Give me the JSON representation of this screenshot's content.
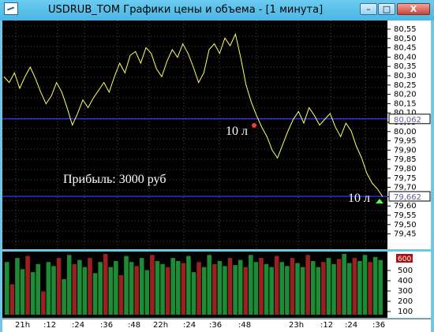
{
  "window": {
    "title": "USDRUB_TOM Графики цены и объема - [1 минута]",
    "controls": {
      "minimize": "–",
      "maximize": "□",
      "close": "X"
    }
  },
  "price_panel": {
    "y_ticks": [
      "80,55",
      "80,50",
      "80,45",
      "80,40",
      "80,35",
      "80,30",
      "80,25",
      "80,20",
      "80,15",
      "80,10",
      "80,05",
      "80,00",
      "79,95",
      "79,90",
      "79,85",
      "79,80",
      "79,75",
      "79,70",
      "79,65",
      "79,60",
      "79,55",
      "79,50",
      "79,45"
    ],
    "level_labels": [
      "80,062",
      "79,662"
    ],
    "annotations": {
      "profit": "Прибыль: 3000 руб",
      "lot_sell": "10 л",
      "lot_buy": "10 л"
    }
  },
  "volume_panel": {
    "y_ticks": [
      "500",
      "400",
      "300",
      "200",
      "100"
    ],
    "current_value": "600"
  },
  "time_axis": {
    "labels": [
      "21h",
      ":12",
      ":24",
      ":36",
      ":48",
      "22h",
      ":24",
      ":36",
      ":48",
      "23h",
      ":12",
      ":24",
      ":36"
    ]
  },
  "chart_data": {
    "type": "line",
    "title": "",
    "y_range": [
      79.45,
      80.55
    ],
    "price_series_approx": [
      80.28,
      80.25,
      80.3,
      80.22,
      80.28,
      80.33,
      80.27,
      80.2,
      80.14,
      80.18,
      80.25,
      80.2,
      80.12,
      80.03,
      80.09,
      80.16,
      80.12,
      80.17,
      80.21,
      80.25,
      80.2,
      80.28,
      80.35,
      80.3,
      80.39,
      80.41,
      80.35,
      80.43,
      80.4,
      80.32,
      80.28,
      80.36,
      80.42,
      80.38,
      80.45,
      80.4,
      80.33,
      80.25,
      80.3,
      80.42,
      80.45,
      80.4,
      80.48,
      80.44,
      80.5,
      80.38,
      80.24,
      80.15,
      80.08,
      80.02,
      79.97,
      79.9,
      79.86,
      79.93,
      80.0,
      80.06,
      80.1,
      80.04,
      80.12,
      80.08,
      80.03,
      80.06,
      80.09,
      80.02,
      79.97,
      80.04,
      80.0,
      79.92,
      79.86,
      79.78,
      79.73,
      79.7,
      79.66
    ],
    "reference_levels": [
      80.062,
      79.662
    ],
    "volume_range": [
      0,
      600
    ],
    "volume_series_approx": [
      520,
      300,
      560,
      450,
      580,
      420,
      500,
      230,
      520,
      480,
      560,
      350,
      590,
      500,
      540,
      470,
      560,
      410,
      520,
      600,
      470,
      530,
      390,
      580,
      520,
      480,
      560,
      440,
      590,
      530,
      500,
      470,
      560,
      530,
      510,
      580,
      420,
      520,
      470,
      590,
      500,
      530,
      480,
      560,
      490,
      540,
      470,
      590,
      520,
      560,
      500,
      470,
      580,
      520,
      480,
      560,
      510,
      470,
      590,
      530,
      470,
      520,
      560,
      500,
      550,
      600,
      510,
      560,
      530,
      590,
      520,
      570,
      540
    ]
  },
  "colors": {
    "background": "#000000",
    "price_line": "#ffff66",
    "level_line": "#3b39ff",
    "up_volume": "#1c8d35",
    "down_volume": "#9d2020"
  }
}
